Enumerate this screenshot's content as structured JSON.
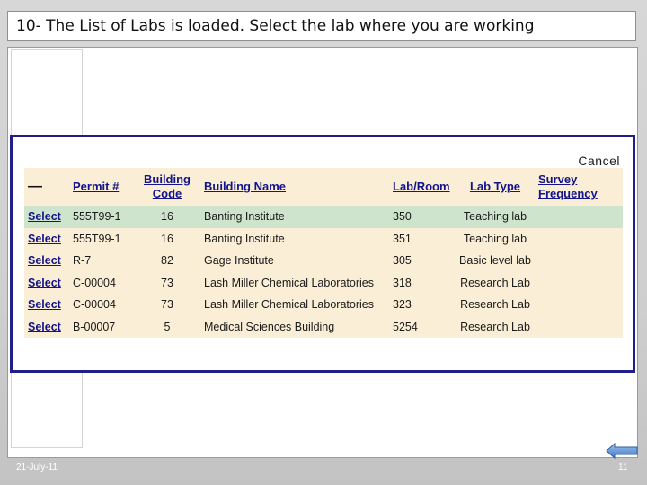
{
  "slide": {
    "title": "10- The List of Labs is loaded. Select the lab where you are working",
    "date": "21-July-11",
    "page_number": "11"
  },
  "screen": {
    "cancel_label": "Cancel",
    "table": {
      "headers": [
        "—",
        "Permit #",
        "Building Code",
        "Building Name",
        "Lab/Room",
        "Lab Type",
        "Survey Frequency"
      ],
      "rows": [
        {
          "select": "Select",
          "permit": "555T99-1",
          "building_code": "16",
          "building_name": "Banting Institute",
          "lab_room": "350",
          "lab_type": "Teaching lab",
          "survey_frequency": "",
          "highlighted": true
        },
        {
          "select": "Select",
          "permit": "555T99-1",
          "building_code": "16",
          "building_name": "Banting Institute",
          "lab_room": "351",
          "lab_type": "Teaching lab",
          "survey_frequency": ""
        },
        {
          "select": "Select",
          "permit": "R-7",
          "building_code": "82",
          "building_name": "Gage Institute",
          "lab_room": "305",
          "lab_type": "Basic level lab",
          "survey_frequency": ""
        },
        {
          "select": "Select",
          "permit": "C-00004",
          "building_code": "73",
          "building_name": "Lash Miller Chemical Laboratories",
          "lab_room": "318",
          "lab_type": "Research Lab",
          "survey_frequency": ""
        },
        {
          "select": "Select",
          "permit": "C-00004",
          "building_code": "73",
          "building_name": "Lash Miller Chemical Laboratories",
          "lab_room": "323",
          "lab_type": "Research Lab",
          "survey_frequency": ""
        },
        {
          "select": "Select",
          "permit": "B-00007",
          "building_code": "5",
          "building_name": "Medical Sciences Building",
          "lab_room": "5254",
          "lab_type": "Research Lab",
          "survey_frequency": ""
        }
      ]
    }
  },
  "colors": {
    "table_bg": "#faeed6",
    "highlight_row": "#cfe4cc",
    "link_blue": "#14148a",
    "frame_border": "#1f1f8a"
  },
  "icons": {
    "nav": "back-arrow-icon"
  }
}
